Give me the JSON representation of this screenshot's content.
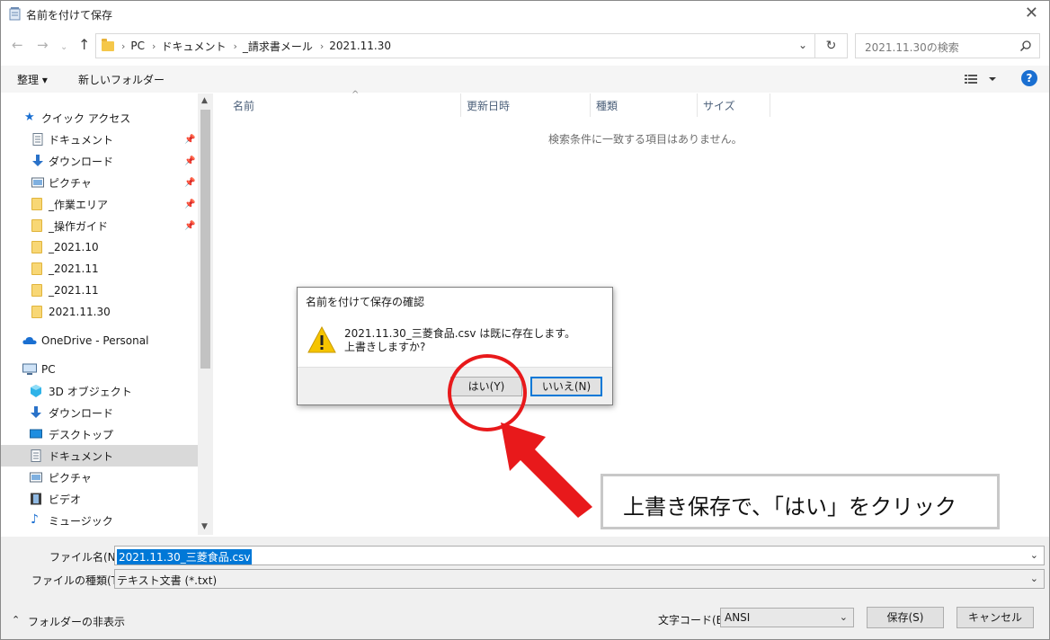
{
  "window": {
    "title": "名前を付けて保存"
  },
  "address": {
    "crumbs": [
      "PC",
      "ドキュメント",
      "_請求書メール",
      "2021.11.30"
    ],
    "search_placeholder": "2021.11.30の検索"
  },
  "toolbar": {
    "organize": "整理 ▾",
    "new_folder": "新しいフォルダー"
  },
  "nav": {
    "quick_access": "クイック アクセス",
    "items": [
      {
        "label": "ドキュメント",
        "pinned": true
      },
      {
        "label": "ダウンロード",
        "pinned": true
      },
      {
        "label": "ピクチャ",
        "pinned": true
      },
      {
        "label": "_作業エリア",
        "pinned": true
      },
      {
        "label": "_操作ガイド",
        "pinned": true
      },
      {
        "label": "_2021.10",
        "pinned": false
      },
      {
        "label": "_2021.11",
        "pinned": false
      },
      {
        "label": "_2021.11",
        "pinned": false
      },
      {
        "label": "2021.11.30",
        "pinned": false
      }
    ],
    "onedrive": "OneDrive - Personal",
    "pc": "PC",
    "pc_items": [
      "3D オブジェクト",
      "ダウンロード",
      "デスクトップ",
      "ドキュメント",
      "ピクチャ",
      "ビデオ",
      "ミュージック"
    ]
  },
  "filelist": {
    "columns": [
      "名前",
      "更新日時",
      "種類",
      "サイズ"
    ],
    "empty_message": "検索条件に一致する項目はありません。"
  },
  "bottom": {
    "filename_label": "ファイル名(N):",
    "filename_value": "2021.11.30_三菱食品.csv",
    "filetype_label": "ファイルの種類(T):",
    "filetype_value": "テキスト文書 (*.txt)",
    "hide_folders": "フォルダーの非表示",
    "encoding_label": "文字コード(E):",
    "encoding_value": "ANSI",
    "save": "保存(S)",
    "cancel": "キャンセル"
  },
  "dialog": {
    "title": "名前を付けて保存の確認",
    "message_line1": "2021.11.30_三菱食品.csv は既に存在します。",
    "message_line2": "上書きしますか?",
    "yes": "はい(Y)",
    "no": "いいえ(N)"
  },
  "annotation": {
    "text": "上書き保存で、「はい」をクリック",
    "color": "#e8191b"
  }
}
